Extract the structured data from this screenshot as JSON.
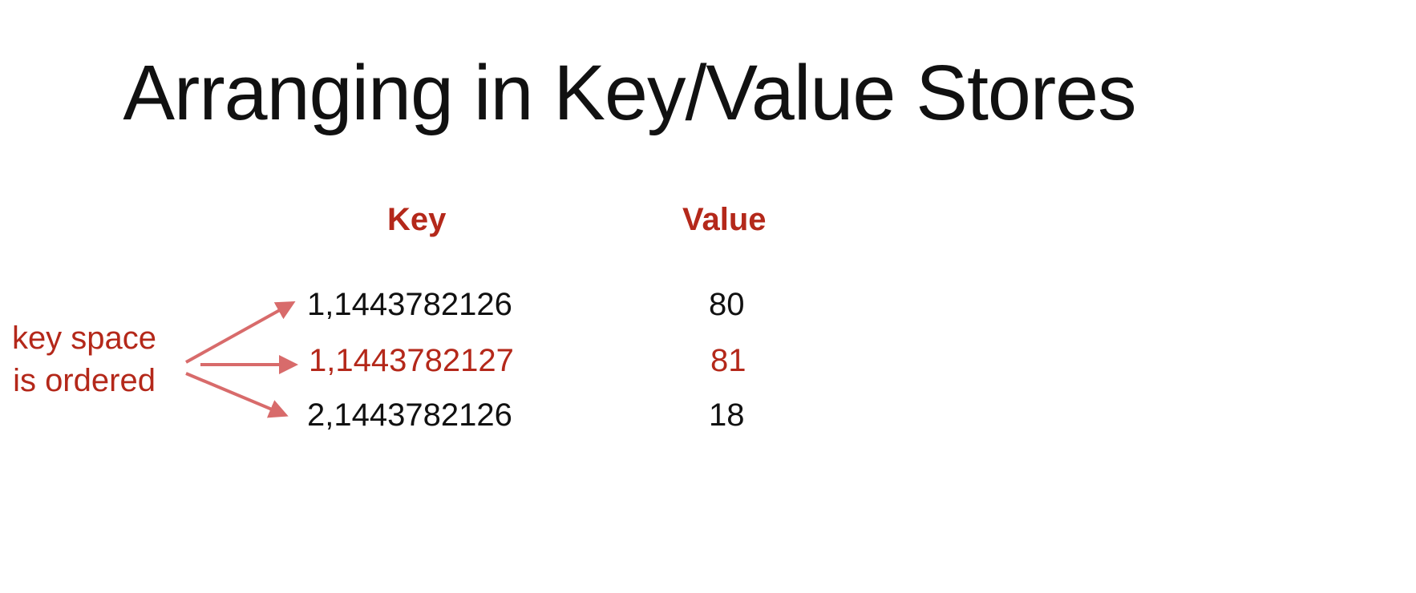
{
  "slide": {
    "title": "Arranging in Key/Value Stores",
    "headers": {
      "key": "Key",
      "value": "Value"
    },
    "rows": [
      {
        "key": "1,1443782126",
        "value": "80",
        "highlighted": false
      },
      {
        "key": "1,1443782127",
        "value": "81",
        "highlighted": true
      },
      {
        "key": "2,1443782126",
        "value": "18",
        "highlighted": false
      }
    ],
    "annotation": {
      "line1": "key space",
      "line2": "is ordered"
    },
    "colors": {
      "accent": "#b4281a",
      "arrow": "#d86b6b",
      "text": "#111111"
    }
  }
}
